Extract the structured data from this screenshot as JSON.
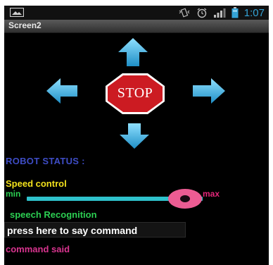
{
  "status_bar": {
    "time": "1:07",
    "icons": [
      "image-icon",
      "vibrate-icon",
      "alarm-icon",
      "signal-icon",
      "battery-icon"
    ],
    "time_color": "#34a3d6"
  },
  "title_bar": {
    "title": "Screen2"
  },
  "controls": {
    "up": "arrow-up-icon",
    "left": "arrow-left-icon",
    "right": "arrow-right-icon",
    "down": "arrow-down-icon",
    "stop_label": "STOP",
    "arrow_color": "#3bb6e8",
    "stop_color": "#cc1b22"
  },
  "robot_status": {
    "label": "ROBOT STATUS :"
  },
  "speed_control": {
    "label": "Speed control",
    "min_label": "min",
    "max_label": "max",
    "value_fraction": 0.95
  },
  "speech": {
    "label": "speech Recognition",
    "button_label": "press here to say command",
    "command_said_label": "command said"
  },
  "colors": {
    "background": "#000000",
    "status_label": "#3e4dc6",
    "speed_label": "#f3e11c",
    "green": "#2ccf52",
    "pink": "#e4277a",
    "track": "#2fc2cc",
    "thumb": "#ec5c93"
  }
}
